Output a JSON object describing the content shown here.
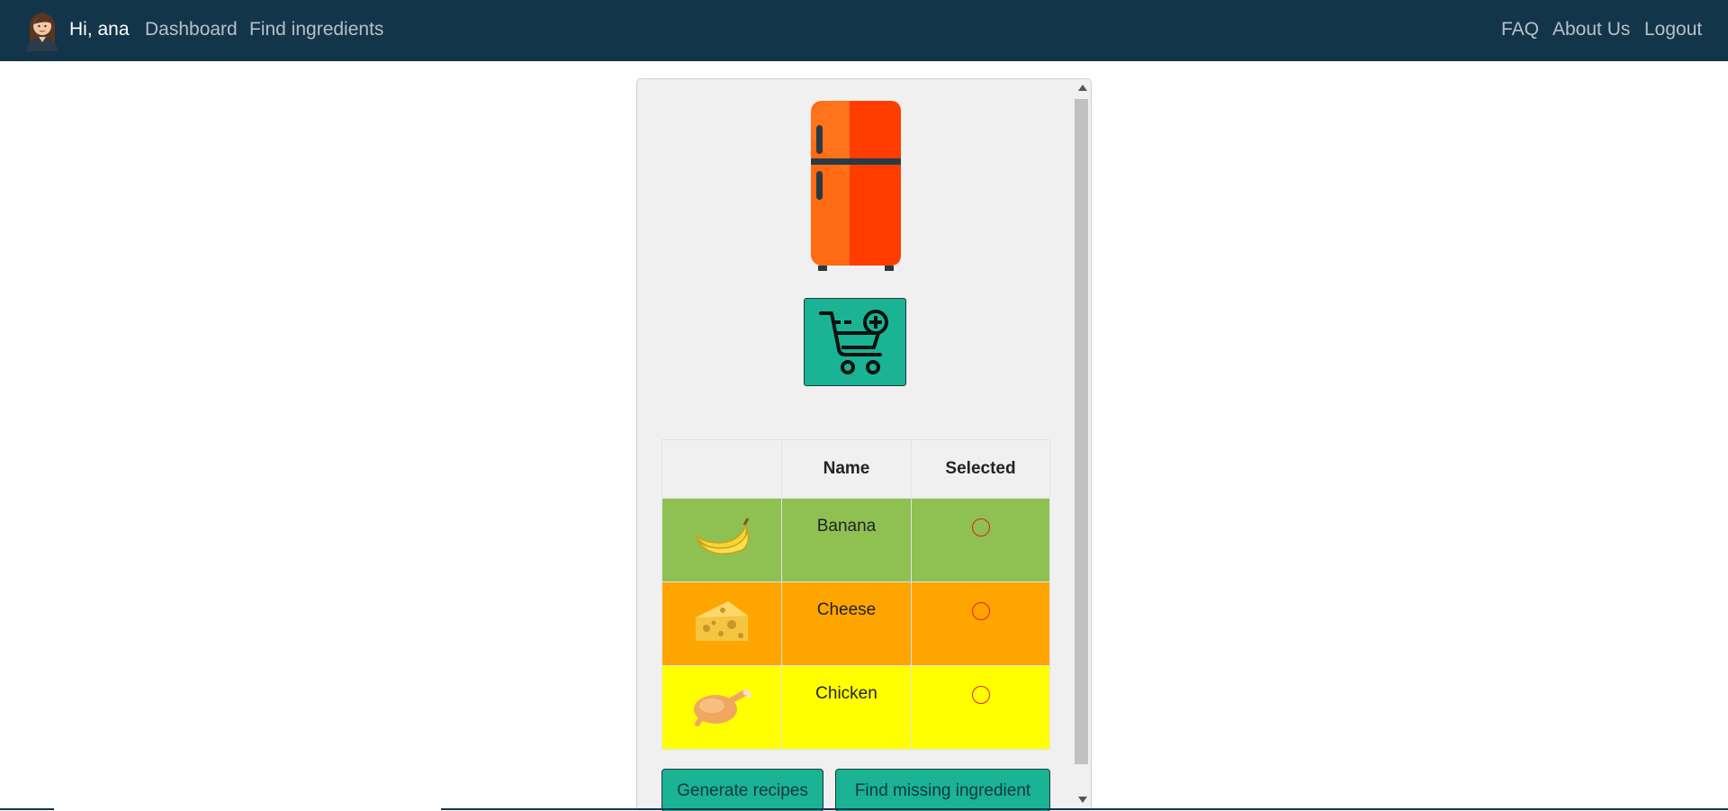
{
  "nav": {
    "greeting": "Hi, ana",
    "links_left": [
      "Dashboard",
      "Find ingredients"
    ],
    "links_right": [
      "FAQ",
      "About Us",
      "Logout"
    ],
    "bg_color": "#13354a"
  },
  "panel": {
    "fridge_icon": "fridge-icon",
    "add_to_cart_icon": "cart-plus-icon",
    "table": {
      "headers": [
        "",
        "Name",
        "Selected"
      ],
      "rows": [
        {
          "icon": "banana-icon",
          "name": "Banana",
          "selected": false,
          "bg": "#8fc052"
        },
        {
          "icon": "cheese-icon",
          "name": "Cheese",
          "selected": false,
          "bg": "#ffa500"
        },
        {
          "icon": "chicken-icon",
          "name": "Chicken",
          "selected": false,
          "bg": "#ffff00"
        }
      ]
    },
    "buttons": {
      "generate": "Generate recipes",
      "find_missing": "Find missing ingredient"
    }
  },
  "colors": {
    "accent": "#1ab394"
  }
}
